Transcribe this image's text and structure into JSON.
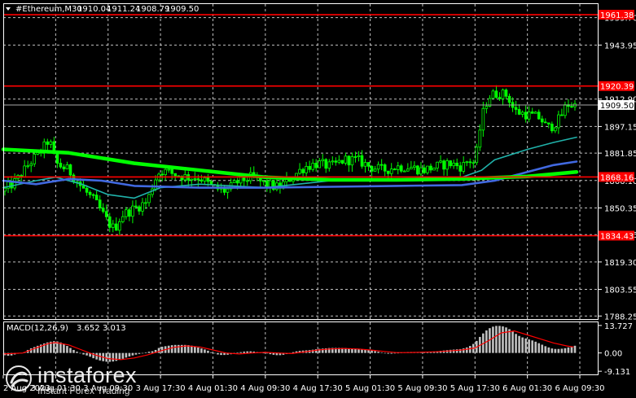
{
  "window": {
    "symbol": "#Ethereum,M30",
    "ohlc": [
      "1910.04",
      "1911.24",
      "1908.79",
      "1909.50"
    ]
  },
  "colors": {
    "background": "#000000",
    "foreground": "#ffffff",
    "grid": "#ffffff",
    "bull": "#00ff00",
    "bear": "#00ff00",
    "level_line": "#ff0000",
    "level_label_bg": "#ff0000",
    "price_label_bg": "#ffffff",
    "ma_slow": "#00ff00",
    "ma_medium": "#4169e1",
    "ma_fast": "#20b2aa",
    "histogram": "#c0c0c0",
    "signal": "#ff0000"
  },
  "chart_data": [
    {
      "type": "candlestick",
      "title": "#Ethereum,M30",
      "y_ticks": [
        1959.7,
        1943.95,
        1912.9,
        1897.15,
        1881.85,
        1866.1,
        1850.35,
        1835.05,
        1819.3,
        1803.55,
        1788.25
      ],
      "y_tick_labels": [
        "1959.70",
        "1943.95",
        "1912.90",
        "1897.15",
        "1881.85",
        "1866.10",
        "1850.35",
        "1835.05",
        "1819.30",
        "1803.55",
        "1788.25"
      ],
      "ylim": [
        1786.5,
        1967.5
      ],
      "x_range": [
        0,
        175
      ],
      "x_ticks": [
        {
          "i": 0,
          "label": "2 Aug 2023"
        },
        {
          "i": 16,
          "label": "3 Aug 01:30"
        },
        {
          "i": 32,
          "label": "3 Aug 09:30"
        },
        {
          "i": 48,
          "label": "3 Aug 17:30"
        },
        {
          "i": 64,
          "label": "4 Aug 01:30"
        },
        {
          "i": 80,
          "label": "4 Aug 09:30"
        },
        {
          "i": 96,
          "label": "4 Aug 17:30"
        },
        {
          "i": 112,
          "label": "5 Aug 01:30"
        },
        {
          "i": 128,
          "label": "5 Aug 09:30"
        },
        {
          "i": 144,
          "label": "5 Aug 17:30"
        },
        {
          "i": 160,
          "label": "6 Aug 01:30"
        },
        {
          "i": 176,
          "label": "6 Aug 09:30"
        }
      ],
      "current_price": {
        "value": 1909.5,
        "label": "1909.50"
      },
      "levels": [
        {
          "value": 1961.38,
          "label": "1961.38"
        },
        {
          "value": 1920.39,
          "label": "1920.39"
        },
        {
          "value": 1868.16,
          "label": "1868.16"
        },
        {
          "value": 1834.43,
          "label": "1834.43"
        }
      ],
      "price_path": [
        [
          0,
          1860
        ],
        [
          4,
          1866
        ],
        [
          8,
          1876
        ],
        [
          12,
          1884
        ],
        [
          14,
          1890
        ],
        [
          16,
          1876
        ],
        [
          20,
          1872
        ],
        [
          24,
          1862
        ],
        [
          28,
          1854
        ],
        [
          32,
          1842
        ],
        [
          34,
          1838
        ],
        [
          36,
          1846
        ],
        [
          40,
          1850
        ],
        [
          44,
          1854
        ],
        [
          46,
          1866
        ],
        [
          48,
          1872
        ],
        [
          52,
          1870
        ],
        [
          56,
          1868
        ],
        [
          60,
          1868
        ],
        [
          64,
          1862
        ],
        [
          68,
          1860
        ],
        [
          72,
          1866
        ],
        [
          76,
          1868
        ],
        [
          80,
          1864
        ],
        [
          84,
          1862
        ],
        [
          88,
          1868
        ],
        [
          92,
          1874
        ],
        [
          96,
          1876
        ],
        [
          100,
          1874
        ],
        [
          104,
          1878
        ],
        [
          108,
          1878
        ],
        [
          112,
          1874
        ],
        [
          116,
          1872
        ],
        [
          120,
          1874
        ],
        [
          124,
          1874
        ],
        [
          128,
          1872
        ],
        [
          132,
          1874
        ],
        [
          136,
          1876
        ],
        [
          140,
          1874
        ],
        [
          142,
          1878
        ],
        [
          144,
          1876
        ],
        [
          146,
          1902
        ],
        [
          148,
          1914
        ],
        [
          150,
          1916
        ],
        [
          152,
          1916
        ],
        [
          154,
          1915
        ],
        [
          156,
          1906
        ],
        [
          160,
          1904
        ],
        [
          164,
          1902
        ],
        [
          166,
          1896
        ],
        [
          168,
          1898
        ],
        [
          170,
          1902
        ],
        [
          172,
          1910
        ],
        [
          174,
          1909.5
        ]
      ],
      "ma_slow": [
        [
          0,
          1884
        ],
        [
          20,
          1882
        ],
        [
          40,
          1876
        ],
        [
          60,
          1872
        ],
        [
          80,
          1868
        ],
        [
          100,
          1866.5
        ],
        [
          120,
          1866.5
        ],
        [
          140,
          1867
        ],
        [
          160,
          1868.5
        ],
        [
          175,
          1871
        ]
      ],
      "ma_medium": [
        [
          0,
          1866
        ],
        [
          10,
          1864
        ],
        [
          20,
          1867
        ],
        [
          30,
          1866
        ],
        [
          40,
          1863
        ],
        [
          60,
          1862
        ],
        [
          80,
          1862
        ],
        [
          100,
          1862.5
        ],
        [
          120,
          1863
        ],
        [
          140,
          1863.5
        ],
        [
          150,
          1866
        ],
        [
          160,
          1871
        ],
        [
          168,
          1875
        ],
        [
          175,
          1877
        ]
      ],
      "ma_fast": [
        [
          0,
          1862
        ],
        [
          10,
          1866
        ],
        [
          16,
          1868
        ],
        [
          24,
          1864
        ],
        [
          32,
          1858
        ],
        [
          40,
          1856
        ],
        [
          48,
          1862
        ],
        [
          60,
          1864
        ],
        [
          70,
          1863
        ],
        [
          80,
          1862
        ],
        [
          100,
          1866
        ],
        [
          120,
          1867
        ],
        [
          140,
          1868
        ],
        [
          146,
          1872
        ],
        [
          150,
          1878
        ],
        [
          160,
          1884
        ],
        [
          168,
          1888
        ],
        [
          175,
          1891
        ]
      ]
    },
    {
      "type": "bar",
      "title": "MACD(12,26,9)",
      "values_label": [
        "3.652",
        "3.013"
      ],
      "y_ticks": [
        13.727,
        0.0,
        -9.131
      ],
      "y_tick_labels": [
        "13.727",
        "0.00",
        "-9.131"
      ],
      "ylim": [
        -10.7,
        15.3
      ],
      "histogram": [
        [
          0,
          -1
        ],
        [
          2,
          -1.5
        ],
        [
          4,
          -0.5
        ],
        [
          6,
          0
        ],
        [
          8,
          2
        ],
        [
          12,
          4.5
        ],
        [
          14,
          5.5
        ],
        [
          16,
          6
        ],
        [
          18,
          5
        ],
        [
          20,
          3
        ],
        [
          22,
          1
        ],
        [
          24,
          -0.5
        ],
        [
          26,
          -1.5
        ],
        [
          28,
          -3
        ],
        [
          30,
          -4
        ],
        [
          32,
          -4.5
        ],
        [
          34,
          -4.2
        ],
        [
          36,
          -3.2
        ],
        [
          38,
          -2
        ],
        [
          40,
          -1
        ],
        [
          42,
          -0.3
        ],
        [
          44,
          0.5
        ],
        [
          46,
          1
        ],
        [
          48,
          3
        ],
        [
          52,
          4
        ],
        [
          56,
          4
        ],
        [
          58,
          3.5
        ],
        [
          60,
          2.5
        ],
        [
          62,
          1.5
        ],
        [
          64,
          0
        ],
        [
          66,
          -1
        ],
        [
          68,
          -1
        ],
        [
          70,
          -0.5
        ],
        [
          72,
          0.3
        ],
        [
          74,
          0.8
        ],
        [
          76,
          0.8
        ],
        [
          78,
          0.3
        ],
        [
          80,
          0
        ],
        [
          82,
          -0.8
        ],
        [
          84,
          -1.2
        ],
        [
          86,
          -0.8
        ],
        [
          88,
          0.2
        ],
        [
          90,
          1
        ],
        [
          94,
          1.5
        ],
        [
          96,
          2
        ],
        [
          100,
          2.5
        ],
        [
          104,
          2.5
        ],
        [
          108,
          2
        ],
        [
          112,
          1.5
        ],
        [
          114,
          0.8
        ],
        [
          116,
          0
        ],
        [
          118,
          -0.5
        ],
        [
          120,
          0
        ],
        [
          124,
          0.5
        ],
        [
          128,
          0.5
        ],
        [
          132,
          0.8
        ],
        [
          136,
          1.5
        ],
        [
          140,
          2
        ],
        [
          142,
          3
        ],
        [
          144,
          5
        ],
        [
          146,
          9
        ],
        [
          148,
          12
        ],
        [
          150,
          13.5
        ],
        [
          152,
          13.5
        ],
        [
          154,
          12.5
        ],
        [
          156,
          10
        ],
        [
          158,
          8
        ],
        [
          160,
          7
        ],
        [
          162,
          6
        ],
        [
          164,
          4.5
        ],
        [
          166,
          3
        ],
        [
          168,
          2
        ],
        [
          170,
          2
        ],
        [
          172,
          2.5
        ],
        [
          174,
          3.6
        ]
      ],
      "signal": [
        [
          0,
          -0.5
        ],
        [
          6,
          0
        ],
        [
          10,
          2.5
        ],
        [
          14,
          4.8
        ],
        [
          16,
          5.2
        ],
        [
          20,
          4
        ],
        [
          24,
          1.5
        ],
        [
          28,
          -1
        ],
        [
          32,
          -2.8
        ],
        [
          36,
          -3.3
        ],
        [
          40,
          -2.5
        ],
        [
          44,
          -1
        ],
        [
          48,
          1
        ],
        [
          52,
          2.8
        ],
        [
          56,
          3.5
        ],
        [
          60,
          3
        ],
        [
          64,
          1.5
        ],
        [
          68,
          0
        ],
        [
          72,
          -0.5
        ],
        [
          76,
          0
        ],
        [
          80,
          0.3
        ],
        [
          84,
          0
        ],
        [
          88,
          -0.3
        ],
        [
          92,
          0.5
        ],
        [
          96,
          1.5
        ],
        [
          100,
          2
        ],
        [
          104,
          2.2
        ],
        [
          108,
          2
        ],
        [
          112,
          1.5
        ],
        [
          116,
          0.8
        ],
        [
          120,
          0.2
        ],
        [
          124,
          0.2
        ],
        [
          128,
          0.4
        ],
        [
          132,
          0.6
        ],
        [
          136,
          1
        ],
        [
          140,
          1.5
        ],
        [
          144,
          2.5
        ],
        [
          148,
          6
        ],
        [
          152,
          10
        ],
        [
          156,
          11
        ],
        [
          160,
          9
        ],
        [
          164,
          7
        ],
        [
          168,
          5
        ],
        [
          172,
          3.5
        ],
        [
          174,
          3
        ]
      ]
    }
  ],
  "branding": {
    "name": "instaforex",
    "tagline": "Instant Forex Trading"
  }
}
